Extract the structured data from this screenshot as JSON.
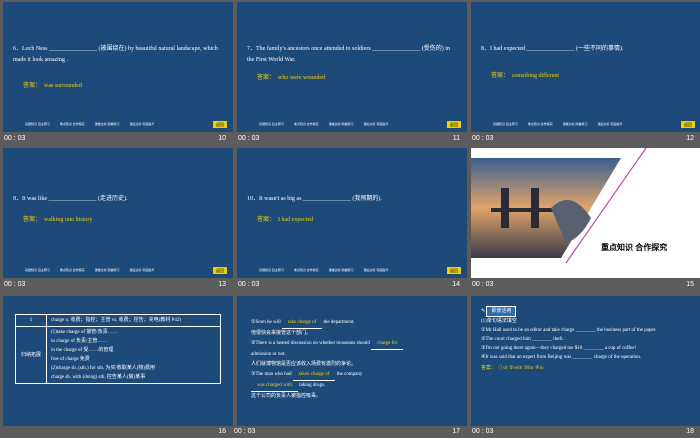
{
  "slides": [
    {
      "num": "10",
      "time": "00 : 03",
      "question": "6．Loch Ness ________________ (被围绕在) by beautiful natural landscape, which made it look amazing .",
      "answer_label": "答案：",
      "answer": "was surrounded"
    },
    {
      "num": "11",
      "time": "00 : 03",
      "question": "7．The family's ancestors once attended to soldiers ________________ (受伤的) in the First World War.",
      "answer_label": "答案：",
      "answer": "who were wounded"
    },
    {
      "num": "12",
      "time": "00 : 03",
      "question": "8．I had expected ________________ (一些不同的事情).",
      "answer_label": "答案：",
      "answer": "something different"
    },
    {
      "num": "13",
      "time": "00 : 03",
      "question": "9．It was like ________________ (走进历史).",
      "answer_label": "答案：",
      "answer": "walking into history"
    },
    {
      "num": "14",
      "time": "00 : 03",
      "question": "10．It wasn't as big as ________________ (我预期的).",
      "answer_label": "答案：",
      "answer": "I had expected"
    },
    {
      "num": "15",
      "time": "00 : 03",
      "section_title": "重点知识 合作探究"
    },
    {
      "num": "16",
      "time": "00 : 03"
    },
    {
      "num": "17",
      "time": "00 : 03"
    },
    {
      "num": "18",
      "time": "00 : 03"
    }
  ],
  "footer_links": [
    "基础知识 自主预习",
    "重点知识 合作探究",
    "课堂达标 随堂练习",
    "课后达标 巩固提升"
  ],
  "back_label": "返回",
  "table": {
    "r1c1": "1",
    "r1c2": "charge n. 收费；指控；主管  vs. 收费；控告；充电(教材 P42)",
    "r2c1": "归纳拓展",
    "r2lines": [
      "(1)take charge of 接管/负责……",
      "in charge of 负责/主管……",
      "in the charge of 受……的管理",
      "free of charge 免费",
      "(2)charge sb. (sth.) for sth. 为买/收取某人(物)费用",
      "charge sb. with (doing) sth. 控告某人(做)某事"
    ]
  },
  "slide17": {
    "l1a": "①Soon he will ",
    "l1b": "take charge of",
    "l1c": " the department.",
    "l2": "他很快会来接管这个部门。",
    "l3a": "②There is a heated discussion on whether museums should ",
    "l3b": "charge for",
    "l4": "admission or not.",
    "l5": "人们就博物馆是否应该收入场费有激烈的争论。",
    "l6a": "③The man who had ",
    "l6b": "taken charge of",
    "l6c": " the company",
    "l7a": "was charged with",
    "l7b": " taking drugs.",
    "l8": "这个公司的负责人被指控吸毒。"
  },
  "slide18": {
    "head": "即景活用",
    "l1": "(1)单句语法填空",
    "l2": "①Mr Hall used to be an editor and take charge ________ the business part of the paper.",
    "l3": "②The court charged him ________ theft.",
    "l4": "③I'm not going there again—they charged me $10 ________ a cup of coffee!",
    "l5": "④It was said that an expert from Beijing was ________ charge of the operation.",
    "ans_label": "答案：",
    "ans": "①of  ②with  ③for  ④in"
  }
}
